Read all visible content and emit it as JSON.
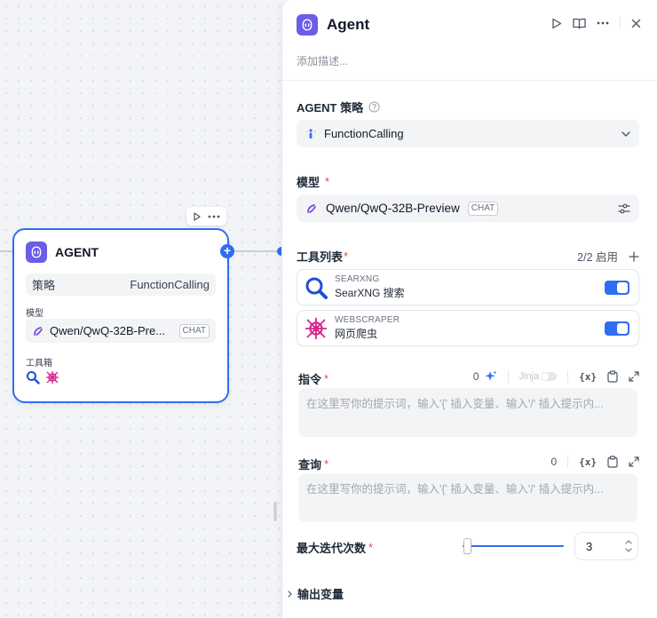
{
  "colors": {
    "accent": "#2f6ef3",
    "agent_icon_bg": "#6b5de8",
    "searxng_icon": "#1f4fd6",
    "webscraper_icon": "#d9268c",
    "required": "#e5484d"
  },
  "node": {
    "title": "AGENT",
    "strategy_label": "策略",
    "strategy_value": "FunctionCalling",
    "model_label": "模型",
    "model_name": "Qwen/QwQ-32B-Pre...",
    "model_badge": "CHAT",
    "tools_label": "工具箱"
  },
  "panel": {
    "title": "Agent",
    "description_placeholder": "添加描述...",
    "strategy": {
      "label": "AGENT 策略",
      "value": "FunctionCalling"
    },
    "model": {
      "label": "模型",
      "required": "*",
      "name": "Qwen/QwQ-32B-Preview",
      "badge": "CHAT"
    },
    "tools": {
      "label": "工具列表",
      "required": "*",
      "status": "2/2 启用",
      "items": [
        {
          "kind": "SEARXNG",
          "name": "SearXNG 搜索",
          "icon": "magnifier-icon",
          "enabled": true
        },
        {
          "kind": "WEBSCRAPER",
          "name": "网页爬虫",
          "icon": "spider-web-icon",
          "enabled": true
        }
      ]
    },
    "instruction": {
      "label": "指令",
      "required": "*",
      "count": "0",
      "jinja_label": "Jinja",
      "var_label": "{x}",
      "placeholder": "在这里写你的提示词，输入'{' 插入变量、输入'/' 插入提示内..."
    },
    "query": {
      "label": "查询",
      "required": "*",
      "count": "0",
      "var_label": "{x}",
      "placeholder": "在这里写你的提示词，输入'{' 插入变量、输入'/' 插入提示内..."
    },
    "max_iterations": {
      "label": "最大迭代次数",
      "required": "*",
      "value": "3",
      "slider_fraction": 0.05
    },
    "output": {
      "label": "输出变量"
    }
  }
}
